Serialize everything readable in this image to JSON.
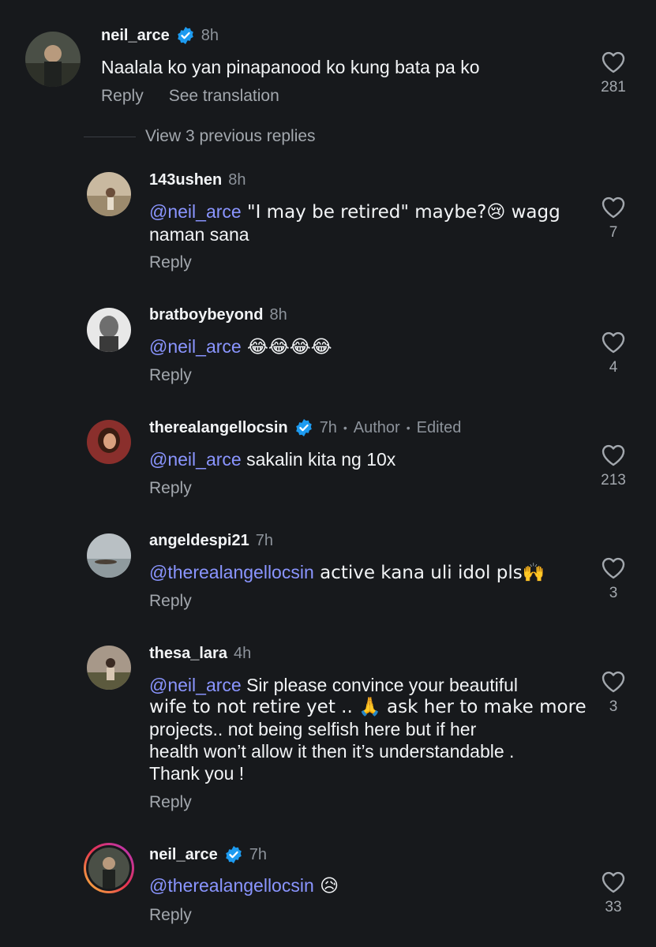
{
  "top_comment": {
    "username": "neil_arce",
    "time": "8h",
    "text": "Naalala ko yan pinapanood ko kung bata pa ko",
    "reply_label": "Reply",
    "translate_label": "See translation",
    "likes": "281"
  },
  "view_previous_label": "View 3 previous replies",
  "replies": [
    {
      "username": "143ushen",
      "time": "8h",
      "mention": "@neil_arce",
      "text_line1": " \"I may be retired\" maybe?😢 wagg",
      "text_line2": "naman sana",
      "reply_label": "Reply",
      "likes": "7"
    },
    {
      "username": "bratboybeyond",
      "time": "8h",
      "mention": "@neil_arce",
      "text_line1": " 😂😂😂😂",
      "reply_label": "Reply",
      "likes": "4"
    },
    {
      "username": "therealangellocsin",
      "time": "7h",
      "author_label": "Author",
      "edited_label": "Edited",
      "mention": "@neil_arce",
      "text_line1": " sakalin kita ng 10x",
      "reply_label": "Reply",
      "likes": "213"
    },
    {
      "username": "angeldespi21",
      "time": "7h",
      "mention": "@therealangellocsin",
      "text_line1": " active kana uli idol pls🙌",
      "reply_label": "Reply",
      "likes": "3"
    },
    {
      "username": "thesa_lara",
      "time": "4h",
      "mention": "@neil_arce",
      "text_line1": " Sir please convince your beautiful",
      "text_line2": "wife to not retire yet .. 🙏 ask her to make more",
      "text_line3": "projects.. not being selfish here but if her",
      "text_line4": "health won’t allow it then it’s understandable .",
      "text_line5": "Thank you !",
      "reply_label": "Reply",
      "likes": "3"
    },
    {
      "username": "neil_arce",
      "time": "7h",
      "mention": "@therealangellocsin",
      "text_line1": " 😥",
      "reply_label": "Reply",
      "likes": "33"
    }
  ],
  "colors": {
    "background": "#17191c",
    "mention": "#8a95ff",
    "verified": "#1d9bf0",
    "muted": "#8d939b"
  },
  "icons": {
    "like": "heart-outline-icon",
    "verified": "verified-badge-icon"
  }
}
